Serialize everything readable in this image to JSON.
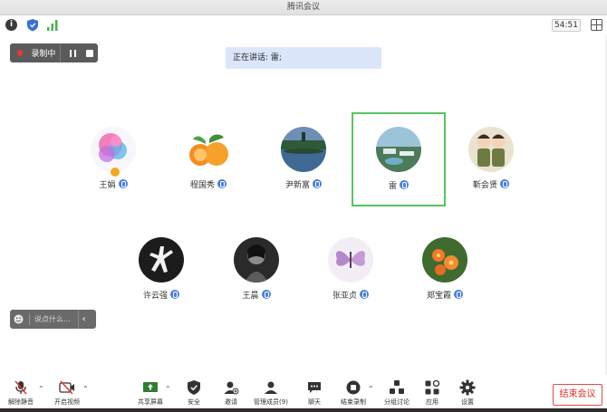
{
  "window": {
    "title": "腾讯会议"
  },
  "info_bar": {
    "timer": "54:51",
    "info_icon": "info-icon",
    "shield_icon": "shield-icon",
    "signal_icon": "signal-icon"
  },
  "recording": {
    "label": "录制中",
    "dot_color": "#e53935"
  },
  "speaking": {
    "text": "正在讲话: 雷;"
  },
  "participants_row1": [
    {
      "name": "王娟",
      "avatar": "pink-ink-splash",
      "host": true
    },
    {
      "name": "程国秀",
      "avatar": "oranges"
    },
    {
      "name": "尹新富",
      "avatar": "lake-reflection"
    },
    {
      "name": "雷",
      "avatar": "resort-aerial",
      "speaking": true
    },
    {
      "name": "靳会贤",
      "avatar": "cartoon-couple"
    }
  ],
  "participants_row2": [
    {
      "name": "许云强",
      "avatar": "jumpman-logo"
    },
    {
      "name": "王晨",
      "avatar": "bw-portrait"
    },
    {
      "name": "张亚贞",
      "avatar": "purple-butterfly"
    },
    {
      "name": "郑宝霞",
      "avatar": "orange-flowers"
    }
  ],
  "chat": {
    "placeholder": "说点什么..."
  },
  "toolbar": {
    "unmute": "解除静音",
    "start_video": "开启视频",
    "share_screen": "共享屏幕",
    "security": "安全",
    "invite": "邀请",
    "manage_members": "管理成员(9)",
    "chat": "聊天",
    "end_recording": "结束录制",
    "breakout": "分组讨论",
    "apps": "应用",
    "settings": "设置",
    "end_meeting": "结束会议"
  },
  "colors": {
    "accent_blue": "#4a7fe0",
    "speaking_border": "#56c45f",
    "end_red": "#e02d2d",
    "banner_bg": "#dbe6fb"
  }
}
